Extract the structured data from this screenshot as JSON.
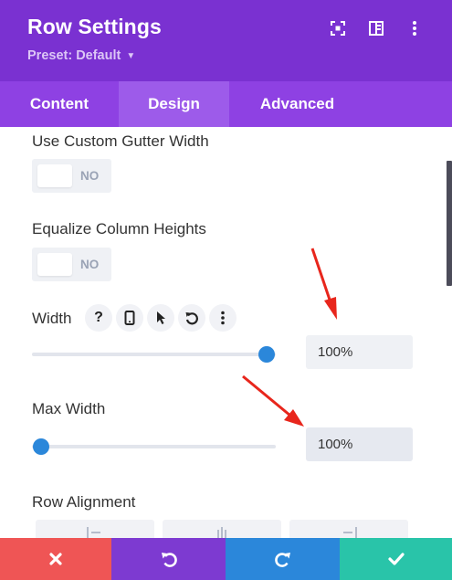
{
  "header": {
    "title": "Row Settings",
    "preset_label": "Preset: Default",
    "icons": [
      "expand-icon",
      "split-view-icon",
      "more-vertical-icon"
    ],
    "bg_color": "#7a31d1"
  },
  "tabs": [
    {
      "label": "Content",
      "active": false
    },
    {
      "label": "Design",
      "active": true
    },
    {
      "label": "Advanced",
      "active": false
    }
  ],
  "settings": {
    "gutter": {
      "label": "Use Custom Gutter Width",
      "state": "NO"
    },
    "equalize": {
      "label": "Equalize Column Heights",
      "state": "NO"
    },
    "width": {
      "label": "Width",
      "value": "100%",
      "slider_fraction": 1.0,
      "option_icons": [
        "help-icon",
        "responsive-phone-icon",
        "hover-pointer-icon",
        "reset-icon",
        "more-icon"
      ]
    },
    "max_width": {
      "label": "Max Width",
      "value": "100%",
      "slider_fraction": 0.0
    },
    "row_alignment": {
      "label": "Row Alignment",
      "options": [
        "align-left-icon",
        "align-center-icon",
        "align-right-icon"
      ]
    }
  },
  "footer": {
    "buttons": [
      "close-icon",
      "undo-icon",
      "redo-icon",
      "check-icon"
    ],
    "colors": [
      "#ef5555",
      "#7d3ad1",
      "#2b87da",
      "#29c4a9"
    ]
  },
  "accent_color": "#2b87da",
  "annotation_color": "#e8261c"
}
